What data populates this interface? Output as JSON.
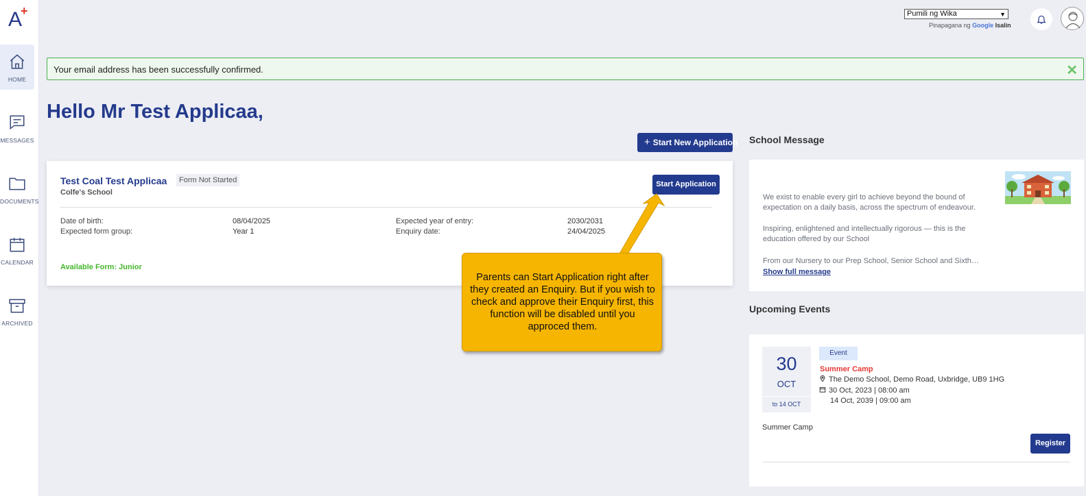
{
  "sidebar": {
    "items": [
      {
        "label": "HOME",
        "icon": "home-icon",
        "active": true
      },
      {
        "label": "MESSAGES",
        "icon": "message-icon"
      },
      {
        "label": "DOCUMENTS",
        "icon": "folder-icon"
      },
      {
        "label": "CALENDAR",
        "icon": "calendar-icon"
      },
      {
        "label": "ARCHIVED",
        "icon": "archive-icon"
      }
    ]
  },
  "header": {
    "language_select": "Pumili ng Wika",
    "powered_by": "Pinapagana ng",
    "google": "Google",
    "translate": "Isalin"
  },
  "alert": {
    "message": "Your email address has been successfully confirmed.",
    "color": "#4caf50"
  },
  "greeting": "Hello Mr Test Applicaa,",
  "start_new_application": "Start New Application",
  "application": {
    "name": "Test Coal Test Applicaa",
    "status": "Form Not Started",
    "school": "Colfe's School",
    "start_button": "Start Application",
    "dob_label": "Date of birth:",
    "dob": "08/04/2025",
    "form_group_label": "Expected form group:",
    "form_group": "Year 1",
    "entry_year_label": "Expected year of entry:",
    "entry_year": "2030/2031",
    "enquiry_date_label": "Enquiry date:",
    "enquiry_date": "24/04/2025",
    "available_form": "Available Form: Junior"
  },
  "callout": {
    "text": "Parents can Start Application right after they created an Enquiry. But if you wish to check and approve their Enquiry first, this function will be disabled until you approced them.",
    "color": "#f6b500"
  },
  "school_message": {
    "title": "School Message",
    "p1": "We exist to enable every girl to achieve beyond the bound of expectation on a daily basis, across the spectrum of endeavour.",
    "p2": "Inspiring, enlightened and intellectually rigorous — this is the education offered by our School",
    "p3": "From our Nursery to our Prep School, Senior School and Sixth…",
    "show_full": "Show full message"
  },
  "events": {
    "title": "Upcoming Events",
    "items": [
      {
        "day": "30",
        "month": "OCT",
        "to": "to 14 OCT",
        "badge": "Event",
        "name": "Summer Camp",
        "location": "The Demo School, Demo Road, Uxbridge, UB9 1HG",
        "start": "30 Oct, 2023 | 08:00 am",
        "end": "14 Oct, 2039 | 09:00 am",
        "description": "Summer Camp",
        "register": "Register"
      }
    ]
  },
  "colors": {
    "brand": "#233b8e",
    "accent_red": "#e53935",
    "success_green": "#45b72b"
  }
}
